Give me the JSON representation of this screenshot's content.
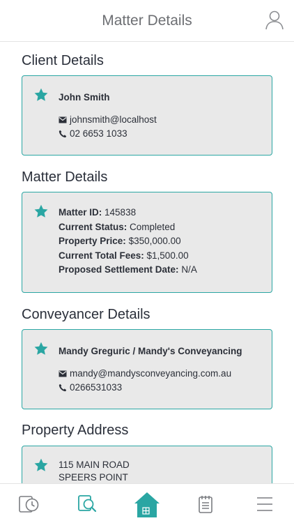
{
  "header": {
    "title": "Matter Details"
  },
  "sections": {
    "client": {
      "title": "Client Details",
      "name": "John Smith",
      "email": "johnsmith@localhost",
      "phone": "02 6653 1033"
    },
    "matter": {
      "title": "Matter Details",
      "rows": [
        {
          "label": "Matter ID:",
          "value": "145838"
        },
        {
          "label": "Current Status:",
          "value": "Completed"
        },
        {
          "label": "Property Price:",
          "value": "$350,000.00"
        },
        {
          "label": "Current Total Fees:",
          "value": "$1,500.00"
        },
        {
          "label": "Proposed Settlement Date:",
          "value": "N/A"
        }
      ]
    },
    "conveyancer": {
      "title": "Conveyancer Details",
      "name": "Mandy Greguric / Mandy's Conveyancing",
      "email": "mandy@mandysconveyancing.com.au",
      "phone": "0266531033"
    },
    "property": {
      "title": "Property Address",
      "line1": "115 MAIN ROAD",
      "line2": "SPEERS POINT"
    }
  },
  "icons": {
    "star": "star-icon",
    "email": "envelope-icon",
    "phone": "phone-icon",
    "profile": "user-icon"
  },
  "tabs": [
    {
      "icon": "history-icon",
      "active": false
    },
    {
      "icon": "document-search-icon",
      "active": false
    },
    {
      "icon": "home-icon",
      "active": true
    },
    {
      "icon": "notepad-icon",
      "active": false
    },
    {
      "icon": "menu-icon",
      "active": false
    }
  ],
  "colors": {
    "accent": "#2aa6a3",
    "card_bg": "#e9e9e9",
    "text": "#2b2f38",
    "muted": "#6d6f73"
  }
}
